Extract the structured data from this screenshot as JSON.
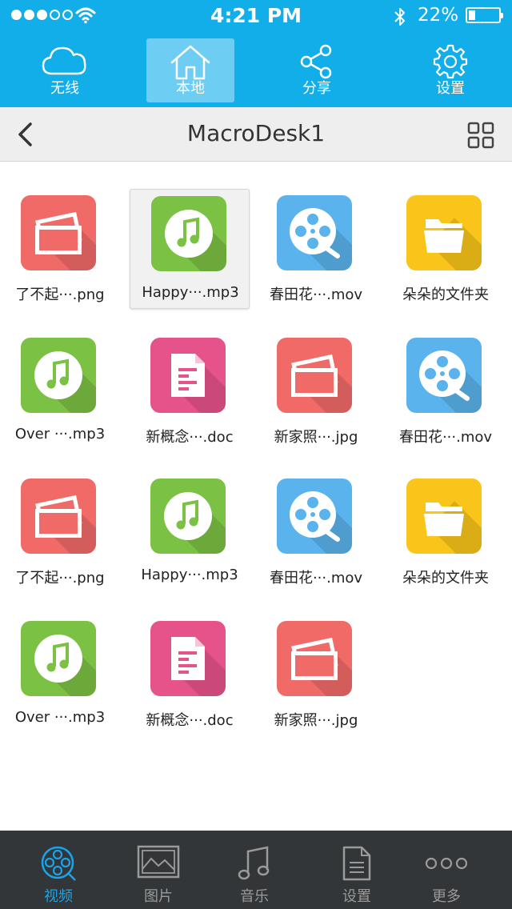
{
  "status": {
    "time": "4:21 PM",
    "battery": "22%",
    "battery_level": 0.22
  },
  "top_tabs": [
    {
      "label": "无线",
      "icon": "cloud-icon"
    },
    {
      "label": "本地",
      "icon": "home-icon",
      "active": true
    },
    {
      "label": "分享",
      "icon": "share-icon"
    },
    {
      "label": "设置",
      "icon": "gear-icon"
    }
  ],
  "nav": {
    "title": "MacroDesk1"
  },
  "files": [
    {
      "name": "了不起···.png",
      "type": "image"
    },
    {
      "name": "Happy···.mp3",
      "type": "music",
      "selected": true
    },
    {
      "name": "春田花···.mov",
      "type": "video"
    },
    {
      "name": "朵朵的文件夹",
      "type": "folder"
    },
    {
      "name": "Over ···.mp3",
      "type": "music"
    },
    {
      "name": "新概念···.doc",
      "type": "doc"
    },
    {
      "name": "新家照···.jpg",
      "type": "image"
    },
    {
      "name": "春田花···.mov",
      "type": "video"
    },
    {
      "name": "了不起···.png",
      "type": "image"
    },
    {
      "name": "Happy···.mp3",
      "type": "music"
    },
    {
      "name": "春田花···.mov",
      "type": "video"
    },
    {
      "name": "朵朵的文件夹",
      "type": "folder"
    },
    {
      "name": "Over ···.mp3",
      "type": "music"
    },
    {
      "name": "新概念···.doc",
      "type": "doc"
    },
    {
      "name": "新家照···.jpg",
      "type": "image"
    }
  ],
  "bottom_tabs": [
    {
      "label": "视频",
      "icon": "film-reel-icon",
      "active": true
    },
    {
      "label": "图片",
      "icon": "picture-icon"
    },
    {
      "label": "音乐",
      "icon": "music-note-icon"
    },
    {
      "label": "设置",
      "icon": "document-icon"
    },
    {
      "label": "更多",
      "icon": "more-dots-icon"
    }
  ],
  "colors": {
    "top_bar": "#11aee9",
    "image_icon": "#f06a68",
    "music_icon": "#7bc143",
    "video_icon": "#5ab3ec",
    "folder_icon": "#f9c51b",
    "doc_icon": "#e6538b",
    "tab_active": "#1aa3e8"
  }
}
